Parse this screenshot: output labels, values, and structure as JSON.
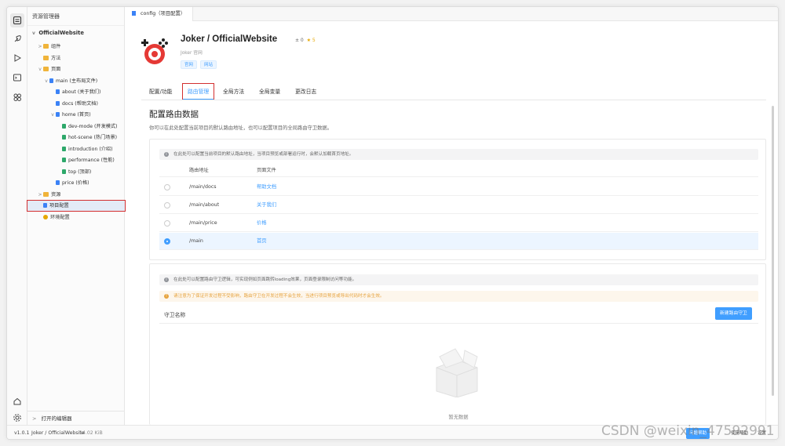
{
  "explorer": {
    "title": "资源管理器",
    "root": "OfficialWebsite",
    "items": [
      {
        "label": "组件",
        "indent": 1,
        "chev": ">",
        "icon": "folder"
      },
      {
        "label": "方法",
        "indent": 1,
        "chev": "",
        "icon": "folder"
      },
      {
        "label": "页面",
        "indent": 1,
        "chev": "v",
        "icon": "folder"
      },
      {
        "label": "main (主布局文件)",
        "indent": 2,
        "chev": "v",
        "icon": "vue"
      },
      {
        "label": "about (关于我们)",
        "indent": 3,
        "chev": "",
        "icon": "vue"
      },
      {
        "label": "docs (帮助文档)",
        "indent": 3,
        "chev": "",
        "icon": "vue"
      },
      {
        "label": "home (首页)",
        "indent": 3,
        "chev": "v",
        "icon": "vue"
      },
      {
        "label": "dev-mode (开发模式)",
        "indent": 4,
        "chev": "",
        "icon": "comp"
      },
      {
        "label": "hot-scene (热门场景)",
        "indent": 4,
        "chev": "",
        "icon": "comp"
      },
      {
        "label": "introduction (介绍)",
        "indent": 4,
        "chev": "",
        "icon": "comp"
      },
      {
        "label": "performance (性能)",
        "indent": 4,
        "chev": "",
        "icon": "comp"
      },
      {
        "label": "top (顶部)",
        "indent": 4,
        "chev": "",
        "icon": "comp"
      },
      {
        "label": "price (价格)",
        "indent": 3,
        "chev": "",
        "icon": "vue"
      },
      {
        "label": "资源",
        "indent": 1,
        "chev": ">",
        "icon": "folder"
      },
      {
        "label": "项目配置",
        "indent": 1,
        "chev": "",
        "icon": "vue",
        "selected": true
      },
      {
        "label": "环境配置",
        "indent": 1,
        "chev": "",
        "icon": "env"
      }
    ],
    "open_editors": "打开的编辑器"
  },
  "tab": {
    "label": "config（项目配置）"
  },
  "project": {
    "title": "Joker / OfficialWebsite",
    "forks": "± 0",
    "stars": "★ 5",
    "subtitle": "Joker 官网",
    "tags": [
      "官网",
      "网站"
    ]
  },
  "subtabs": [
    "配置/功能",
    "路由管理",
    "全局方法",
    "全局变量",
    "更改日志"
  ],
  "route": {
    "title": "配置路由数据",
    "desc": "你可以在此处配置当前项目的默认路由地址，也可以配置项目的全局路由守卫数据。",
    "notice": "在此处可以配置当前项目的默认路由地址，当项目预览或部署运行时，会默认加载首页地址。",
    "col_path": "路由地址",
    "col_page": "页面文件",
    "rows": [
      {
        "path": "/main/docs",
        "page": "帮助文档",
        "selected": false
      },
      {
        "path": "/main/about",
        "page": "关于我们",
        "selected": false
      },
      {
        "path": "/main/price",
        "page": "价格",
        "selected": false
      },
      {
        "path": "/main",
        "page": "首页",
        "selected": true
      }
    ]
  },
  "guard": {
    "notice": "在此处可以配置路由守卫逻辑，可实现例如页面跳转loading效果，页面登录限制访问等功能。",
    "warning": "请注意为了保证开发过程不受影响，路由守卫在开发过程不会生效，当进行项目预览或导出代码时才会生效。",
    "label": "守卫名称",
    "add_button": "新建路由守卫",
    "empty": "暂无数据"
  },
  "status": {
    "version": "v1.0.1",
    "project": "Joker / OfficialWebsite",
    "size": "14.02 KiB",
    "right1": "问题帮助",
    "right2": "使用帮助",
    "right3": "设置"
  },
  "watermark": "CSDN @weixin_47592991",
  "colors": {
    "accent": "#409eff",
    "highlight": "#d32f2f",
    "warning": "#e6a23c"
  }
}
